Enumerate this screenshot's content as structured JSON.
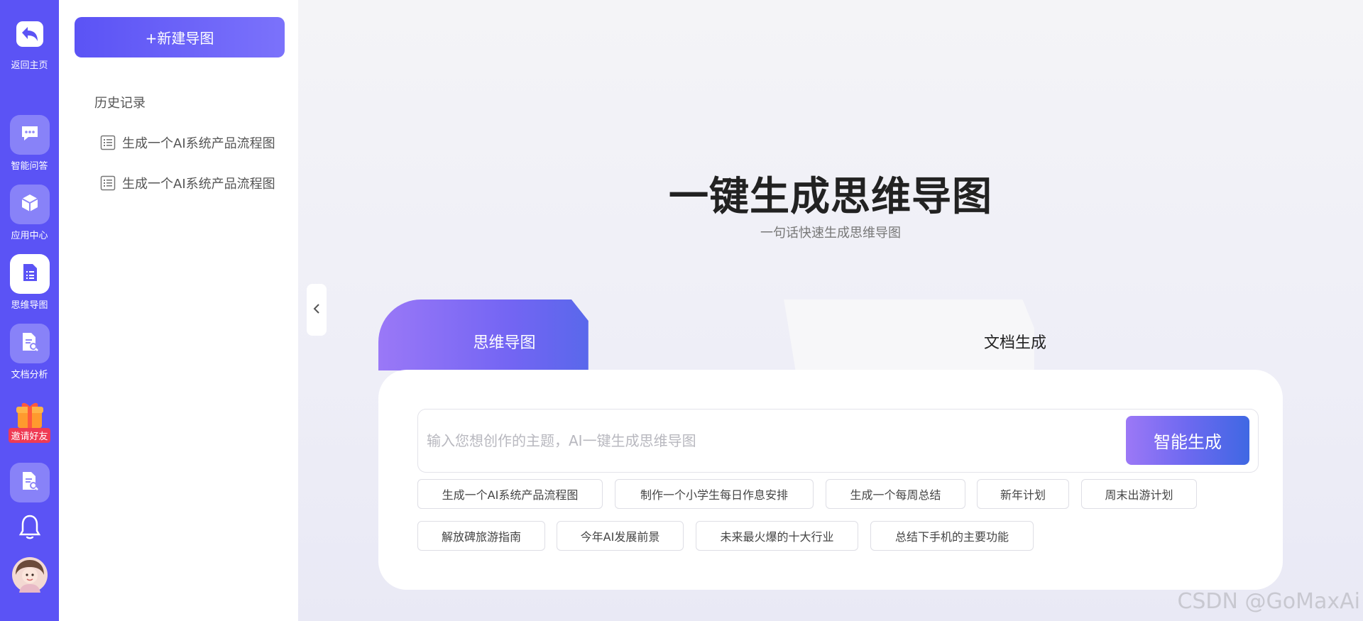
{
  "rail": {
    "back_label": "返回主页",
    "items": [
      {
        "label": "智能问答",
        "icon": "chat-bubble-icon"
      },
      {
        "label": "应用中心",
        "icon": "cube-icon"
      },
      {
        "label": "思维导图",
        "icon": "mindmap-icon",
        "active": true
      },
      {
        "label": "文档分析",
        "icon": "document-search-icon"
      },
      {
        "label": "邀请好友",
        "icon": "gift-icon"
      }
    ]
  },
  "history": {
    "new_button": "+新建导图",
    "title": "历史记录",
    "items": [
      "生成一个AI系统产品流程图",
      "生成一个AI系统产品流程图"
    ]
  },
  "main": {
    "title": "一键生成思维导图",
    "subtitle": "一句话快速生成思维导图",
    "tabs": [
      {
        "label": "思维导图",
        "active": true
      },
      {
        "label": "文档生成",
        "active": false
      }
    ],
    "input_placeholder": "输入您想创作的主题，AI一键生成思维导图",
    "generate_button": "智能生成",
    "suggestions_row1": [
      "生成一个AI系统产品流程图",
      "制作一个小学生每日作息安排",
      "生成一个每周总结",
      "新年计划",
      "周末出游计划"
    ],
    "suggestions_row2": [
      "解放碑旅游指南",
      "今年AI发展前景",
      "未来最火爆的十大行业",
      "总结下手机的主要功能"
    ]
  },
  "watermark": "CSDN @GoMaxAi",
  "colors": {
    "accent": "#5b53f5",
    "gradient_end": "#3f68e3"
  }
}
